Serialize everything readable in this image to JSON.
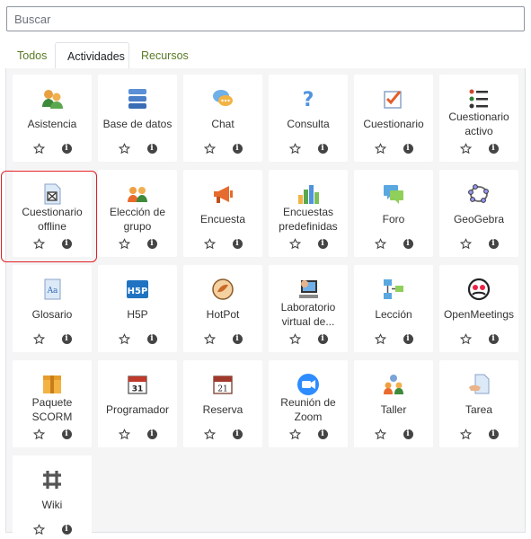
{
  "search": {
    "placeholder": "Buscar"
  },
  "tabs": [
    {
      "label": "Todos",
      "active": false
    },
    {
      "label": "Actividades",
      "active": true
    },
    {
      "label": "Recursos",
      "active": false
    }
  ],
  "activities": [
    {
      "label": "Asistencia",
      "icon": "attendance-icon"
    },
    {
      "label": "Base de datos",
      "icon": "database-icon"
    },
    {
      "label": "Chat",
      "icon": "chat-icon"
    },
    {
      "label": "Consulta",
      "icon": "question-icon"
    },
    {
      "label": "Cuestionario",
      "icon": "quiz-icon"
    },
    {
      "label": "Cuestionario activo",
      "icon": "active-quiz-icon"
    },
    {
      "label": "Cuestionario offline",
      "icon": "offline-quiz-icon"
    },
    {
      "label": "Elección de grupo",
      "icon": "group-choice-icon"
    },
    {
      "label": "Encuesta",
      "icon": "megaphone-icon"
    },
    {
      "label": "Encuestas predefinidas",
      "icon": "bar-chart-icon"
    },
    {
      "label": "Foro",
      "icon": "forum-icon"
    },
    {
      "label": "GeoGebra",
      "icon": "geogebra-icon"
    },
    {
      "label": "Glosario",
      "icon": "glossary-icon"
    },
    {
      "label": "H5P",
      "icon": "h5p-icon"
    },
    {
      "label": "HotPot",
      "icon": "hotpot-icon"
    },
    {
      "label": "Laboratorio virtual de...",
      "icon": "virtual-lab-icon"
    },
    {
      "label": "Lección",
      "icon": "lesson-icon"
    },
    {
      "label": "OpenMeetings",
      "icon": "openmeetings-icon"
    },
    {
      "label": "Paquete SCORM",
      "icon": "scorm-package-icon"
    },
    {
      "label": "Programador",
      "icon": "calendar-31-icon"
    },
    {
      "label": "Reserva",
      "icon": "calendar-21-icon"
    },
    {
      "label": "Reunión de Zoom",
      "icon": "zoom-icon"
    },
    {
      "label": "Taller",
      "icon": "workshop-icon"
    },
    {
      "label": "Tarea",
      "icon": "assignment-icon"
    },
    {
      "label": "Wiki",
      "icon": "wiki-icon"
    }
  ],
  "colors": {
    "tab_link": "#5a7a25",
    "highlight": "#e31e24",
    "panel_bg": "#f5f5f5"
  }
}
